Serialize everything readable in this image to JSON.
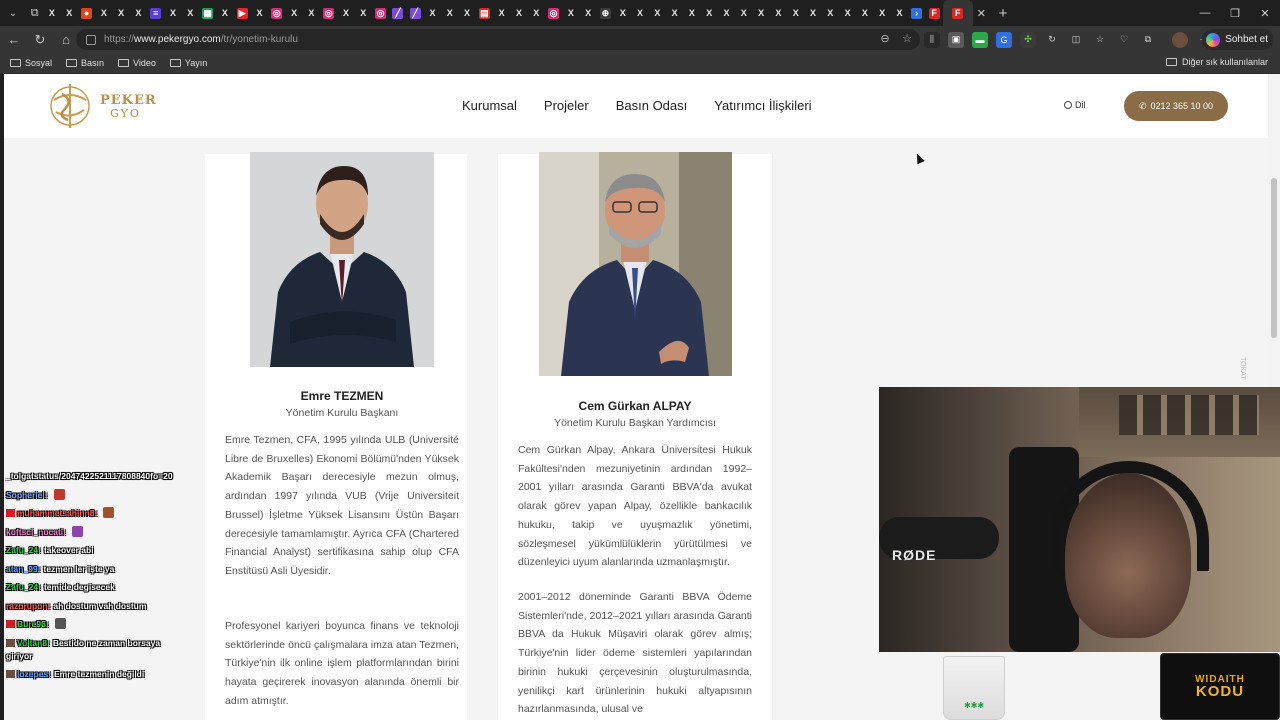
{
  "browser": {
    "tab_favicons": [
      {
        "icon": "x-icon",
        "color": "#000000",
        "glyph": "X"
      },
      {
        "icon": "x-icon",
        "color": "#000000",
        "glyph": "X"
      },
      {
        "icon": "reddit-icon",
        "color": "#e0451f",
        "glyph": "●"
      },
      {
        "icon": "x-icon",
        "color": "#000000",
        "glyph": "X"
      },
      {
        "icon": "x-icon",
        "color": "#000000",
        "glyph": "X"
      },
      {
        "icon": "x-icon",
        "color": "#000000",
        "glyph": "X"
      },
      {
        "icon": "doc-icon",
        "color": "#5b3fd1",
        "glyph": "≡"
      },
      {
        "icon": "x-icon",
        "color": "#000000",
        "glyph": "X"
      },
      {
        "icon": "x-icon",
        "color": "#000000",
        "glyph": "X"
      },
      {
        "icon": "sheet-icon",
        "color": "#1e9e5a",
        "glyph": "▦"
      },
      {
        "icon": "x-icon",
        "color": "#000000",
        "glyph": "X"
      },
      {
        "icon": "youtube-icon",
        "color": "#e5232e",
        "glyph": "▶"
      },
      {
        "icon": "x-icon",
        "color": "#000000",
        "glyph": "X"
      },
      {
        "icon": "instagram-icon",
        "color": "#d62976",
        "glyph": "◎"
      },
      {
        "icon": "x-icon",
        "color": "#000000",
        "glyph": "X"
      },
      {
        "icon": "x-icon",
        "color": "#000000",
        "glyph": "X"
      },
      {
        "icon": "instagram-icon",
        "color": "#d62976",
        "glyph": "◎"
      },
      {
        "icon": "x-icon",
        "color": "#000000",
        "glyph": "X"
      },
      {
        "icon": "x-icon",
        "color": "#000000",
        "glyph": "X"
      },
      {
        "icon": "instagram-icon",
        "color": "#d62976",
        "glyph": "◎"
      },
      {
        "icon": "feather-icon",
        "color": "#7b4bd8",
        "glyph": "╱"
      },
      {
        "icon": "feather-icon",
        "color": "#7b4bd8",
        "glyph": "╱"
      },
      {
        "icon": "x-icon",
        "color": "#000000",
        "glyph": "X"
      },
      {
        "icon": "x-icon",
        "color": "#000000",
        "glyph": "X"
      },
      {
        "icon": "x-icon",
        "color": "#000000",
        "glyph": "X"
      },
      {
        "icon": "news-icon",
        "color": "#c9302c",
        "glyph": "▤"
      },
      {
        "icon": "x-icon",
        "color": "#000000",
        "glyph": "X"
      },
      {
        "icon": "x-icon",
        "color": "#000000",
        "glyph": "X"
      },
      {
        "icon": "x-icon",
        "color": "#000000",
        "glyph": "X"
      },
      {
        "icon": "instagram-icon",
        "color": "#d62976",
        "glyph": "◎"
      },
      {
        "icon": "x-icon",
        "color": "#000000",
        "glyph": "X"
      },
      {
        "icon": "x-icon",
        "color": "#000000",
        "glyph": "X"
      },
      {
        "icon": "globe-icon",
        "color": "#3a3a3a",
        "glyph": "⊕"
      },
      {
        "icon": "x-icon",
        "color": "#000000",
        "glyph": "X"
      },
      {
        "icon": "x-icon",
        "color": "#000000",
        "glyph": "X"
      },
      {
        "icon": "x-icon",
        "color": "#000000",
        "glyph": "X"
      },
      {
        "icon": "x-icon",
        "color": "#000000",
        "glyph": "X"
      },
      {
        "icon": "x-icon",
        "color": "#000000",
        "glyph": "X"
      },
      {
        "icon": "x-icon",
        "color": "#000000",
        "glyph": "X"
      },
      {
        "icon": "x-icon",
        "color": "#000000",
        "glyph": "X"
      },
      {
        "icon": "x-icon",
        "color": "#000000",
        "glyph": "X"
      },
      {
        "icon": "x-icon",
        "color": "#000000",
        "glyph": "X"
      },
      {
        "icon": "x-icon",
        "color": "#000000",
        "glyph": "X"
      },
      {
        "icon": "x-icon",
        "color": "#000000",
        "glyph": "X"
      },
      {
        "icon": "x-icon",
        "color": "#000000",
        "glyph": "X"
      },
      {
        "icon": "x-icon",
        "color": "#000000",
        "glyph": "X"
      },
      {
        "icon": "x-icon",
        "color": "#000000",
        "glyph": "X"
      },
      {
        "icon": "x-icon",
        "color": "#000000",
        "glyph": "X"
      },
      {
        "icon": "x-icon",
        "color": "#000000",
        "glyph": "X"
      },
      {
        "icon": "x-icon",
        "color": "#000000",
        "glyph": "X"
      },
      {
        "icon": "arrow-icon",
        "color": "#2f6fe0",
        "glyph": "›"
      },
      {
        "icon": "f-icon",
        "color": "#d62828",
        "glyph": "F"
      }
    ],
    "active_tab_favicon": {
      "icon": "f-icon",
      "color": "#d62828",
      "glyph": "F"
    },
    "new_tab_glyph": "+",
    "url_prefix": "https://",
    "url_host": "www.pekergyo.com",
    "url_path": "/tr/yonetim-kurulu",
    "chat_button_label": "Sohbet et",
    "bookmarks": [
      "Sosyal",
      "Basın",
      "Video",
      "Yayın"
    ],
    "other_bookmarks_label": "Diğer sık kullanılanlar"
  },
  "site": {
    "logo_line1": "PEKER",
    "logo_line2": "GYO",
    "nav": [
      "Kurumsal",
      "Projeler",
      "Basın Odası",
      "Yatırımcı İlişkileri"
    ],
    "language_label": "Dil",
    "phone": "0212 365 10 00",
    "brand_color": "#8a6d47"
  },
  "members": [
    {
      "name": "Emre TEZMEN",
      "title": "Yönetim Kurulu Başkanı",
      "bio_paragraphs": [
        "Emre Tezmen, CFA, 1995 yılında ULB (Université Libre de Bruxelles) Ekonomi Bölümü'nden Yüksek Akademik Başarı derecesiyle mezun olmuş, ardından 1997 yılında VUB (Vrije Universiteit Brussel) İşletme Yüksek Lisansını Üstün Başarı derecesiyle tamamlamıştır. Ayrıca CFA (Chartered Financial Analyst) sertifikasına sahip olup CFA Enstitüsü Asli Üyesidir.",
        "Profesyonel kariyeri boyunca finans ve teknoloji sektörlerinde öncü çalışmalara imza atan Tezmen, Türkiye'nin ilk online işlem platformlarından birini hayata geçirerek inovasyon alanında önemli bir adım atmıştır."
      ]
    },
    {
      "name": "Cem Gürkan ALPAY",
      "title": "Yönetim Kurulu Başkan Yardımcısı",
      "bio_paragraphs": [
        "Cem Gürkan Alpay, Ankara Üniversitesi Hukuk Fakültesi'nden mezuniyetinin ardından 1992–2001 yılları arasında Garanti BBVA'da avukat olarak görev yapan Alpay, özellikle bankacılık hukuku, takip ve uyuşmazlık yönetimi, sözleşmesel yükümlülüklerin yürütülmesi ve düzenleyici uyum alanlarında uzmanlaşmıştır.",
        "2001–2012 döneminde Garanti BBVA Ödeme Sistemleri'nde, 2012–2021 yılları arasında Garanti BBVA da Hukuk Müşaviri olarak görev almış; Türkiye'nin lider ödeme sistemleri yapılarından birinin hukuki çerçevesinin oluşturulmasında, yenilikçi kart ürünlerinin hukuki altyapısının hazırlanmasında, ulusal ve"
      ]
    }
  ],
  "stream": {
    "chat": [
      {
        "user": "_tolgatstatus/2047422521117808840fo=20",
        "color": "#ffffff",
        "text": "",
        "badge": "",
        "emote": ""
      },
      {
        "user": "Sopheriel:",
        "color": "#7aa7ff",
        "text": "",
        "badge": "",
        "emote": "#c0392b"
      },
      {
        "user": "muhammetsahinn8:",
        "color": "#ff5a5a",
        "text": "",
        "badge": "#d11e1e",
        "emote": "#a0522d"
      },
      {
        "user": "koftsci_nocati:",
        "color": "#ff7ad9",
        "text": "",
        "badge": "",
        "emote": "#8e44ad"
      },
      {
        "user": "Zafu_24:",
        "color": "#39d353",
        "text": "takeover abi",
        "badge": "",
        "emote": ""
      },
      {
        "user": "atan_99:",
        "color": "#5aa0ff",
        "text": "tezmen ler işte ya",
        "badge": "",
        "emote": ""
      },
      {
        "user": "Zafu_24:",
        "color": "#39d353",
        "text": "temide degisecek",
        "badge": "",
        "emote": ""
      },
      {
        "user": "razorupon:",
        "color": "#ff5a5a",
        "text": "ah dostum vah dostum",
        "badge": "",
        "emote": ""
      },
      {
        "user": "Bure96:",
        "color": "#39d353",
        "text": "",
        "badge": "#d11e1e",
        "emote": "#555555"
      },
      {
        "user": "Voltan8:",
        "color": "#39d353",
        "text": "Bestido ne zaman borsaya giriyor",
        "badge": "#6b4e3d",
        "emote": ""
      },
      {
        "user": "lozepes:",
        "color": "#5aa0ff",
        "text": "Emre tezmenin değildi",
        "badge": "#6b4e3d",
        "emote": ""
      }
    ],
    "brand_line1": "WIDAITH",
    "brand_line2": "KODU",
    "mic_label": "RØDE",
    "cup_deco": "✱✱✱"
  }
}
